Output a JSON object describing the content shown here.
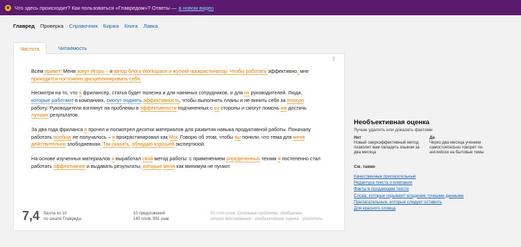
{
  "banner": {
    "text": "Что здесь происходит? Как пользоваться «Главредом»? Ответы —",
    "link": "в новом видео"
  },
  "nav": [
    {
      "label": "Главред",
      "name": "nav-glavred"
    },
    {
      "label": "Проверка",
      "name": "nav-check"
    },
    {
      "label": "Справочник",
      "name": "nav-reference"
    },
    {
      "label": "Биржа",
      "name": "nav-exchange"
    },
    {
      "label": "Книга",
      "name": "nav-book"
    },
    {
      "label": "Лавка",
      "name": "nav-shop"
    }
  ],
  "tabs": {
    "purity": "Чистота",
    "readability": "Читаемость"
  },
  "paragraphs": [
    [
      "Всем",
      " привет! ",
      "Меня",
      " зовут Игорь – ",
      "я",
      " автор блога Workspace и жуткий прокрастинатор. Чтобы работать ",
      "эффективно",
      ", ",
      "мне",
      " приходится постоянно дисциплинировать себя."
    ],
    [
      "Несмотря на то, что ",
      "я",
      " фрилансер, статья будет полезна и для наемных сотрудников, и для ",
      "их",
      " руководителей. Люди, ",
      "которые работают",
      " в компаниях, ",
      "смогут поднять",
      " ",
      "эффективность",
      ", чтобы выполнять планы и не винить себя за ",
      "плохую",
      " работу. Руководители взглянут на проблемы в ",
      "эффективности",
      " подчиненных с ",
      "их",
      " стороны и смогут помочь ",
      "им",
      " достичь ",
      "лучших",
      " результатов."
    ],
    [
      "За два года фриланса ",
      "я",
      " прочел и посмотрел десятки материалов для развития навыка продуктивной работы. Поначалу работать ",
      "вообще",
      " не получалось – ",
      "я",
      " прокрастинировал как ",
      "Мог",
      ". Говорю об этом, чтобы ",
      "вы",
      " поняли, что тема для ",
      "меня",
      " ",
      "действительно",
      " злободневная. ",
      "Так сказать,",
      " ",
      "обладаю хорошей",
      " экспертизой."
    ],
    [
      "На основе изученных материалов ",
      "я",
      " выработал ",
      "свой",
      " метод работы: с применением ",
      "определенных",
      " техник ",
      "я",
      " постепенно стал работать ",
      "эффективнее",
      " и выдавать результаты, ",
      "которые",
      " ",
      "меня",
      " как минимум не пугают."
    ]
  ],
  "footer": {
    "score": "7,4",
    "score_note_1": "балла из 10",
    "score_note_2": "по шкале Главреда",
    "stats_1": "10 предложений",
    "stats_2": "140 слов, 991 знак",
    "problems_1": "30 стоп-слов. Основные проблемы: обобщение",
    "problems_2": "личное местоимение · необъективная оценка · усилитель"
  },
  "side": {
    "title": "Необъективная оценка",
    "subtitle": "Лучше удалить или доказать фактами",
    "no_head": "Нет",
    "no_text": "Новый сверхэффективный метод позволит вам овладеть языком за два месяца",
    "yes_head": "Да",
    "yes_text": "Через два месяца ученики самостоятельно говорят по-английски на бытовые темы",
    "see_also": "См. также",
    "links": [
      "Качественные прилагательные",
      "Редактура текста о компании",
      "Факты в продающем тексте",
      "Слова, которые скрывают владение точными данными",
      "Прилагательные, которые следует оставить",
      "Для красного словца"
    ]
  },
  "colors": {
    "banner": "#5b1a6e",
    "accent_orange": "#e07b00",
    "link_blue": "#1a66b3"
  },
  "icons": {
    "banner": "smile-icon",
    "share": "share-icon"
  }
}
